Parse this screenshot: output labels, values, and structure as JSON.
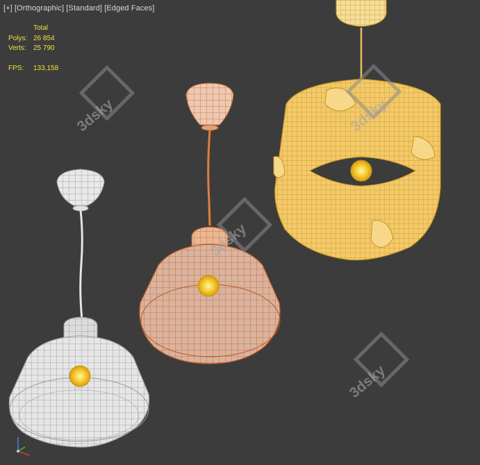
{
  "viewport": {
    "label_plus": "[+]",
    "label_view": "[Orthographic]",
    "label_shading": "[Standard]",
    "label_mode": "[Edged Faces]"
  },
  "stats": {
    "header": "Total",
    "polys_label": "Polys:",
    "polys_value": "26 854",
    "verts_label": "Verts:",
    "verts_value": "25 790",
    "fps_label": "FPS:",
    "fps_value": "133,158"
  },
  "watermarks": [
    "3dsky",
    "3dsky",
    "3dsky",
    "3dsky"
  ],
  "colors": {
    "background": "#3c3c3c",
    "stats_text": "#f2e23a",
    "white_wire": "#dcdcdc",
    "orange_wire": "#e0803c",
    "yellow_wire": "#f1c24a",
    "bulb": "#f7d23a"
  },
  "gizmo_icon": "axis-gizmo-icon"
}
